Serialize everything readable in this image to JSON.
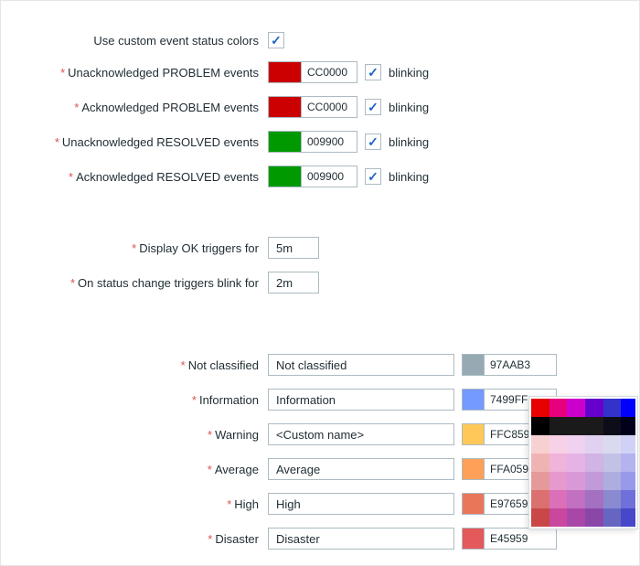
{
  "labels": {
    "use_custom": "Use custom event status colors",
    "unack_problem": "Unacknowledged PROBLEM events",
    "ack_problem": "Acknowledged PROBLEM events",
    "unack_resolved": "Unacknowledged RESOLVED events",
    "ack_resolved": "Acknowledged RESOLVED events",
    "display_ok": "Display OK triggers for",
    "blink_for": "On status change triggers blink for",
    "blinking": "blinking"
  },
  "use_custom_checked": true,
  "events": {
    "unack_problem": {
      "color": "#CC0000",
      "code": "CC0000",
      "blink": true
    },
    "ack_problem": {
      "color": "#CC0000",
      "code": "CC0000",
      "blink": true
    },
    "unack_resolved": {
      "color": "#009900",
      "code": "009900",
      "blink": true
    },
    "ack_resolved": {
      "color": "#009900",
      "code": "009900",
      "blink": true
    }
  },
  "timers": {
    "display_ok": "5m",
    "blink_for": "2m"
  },
  "severities": [
    {
      "label": "Not classified",
      "name": "Not classified",
      "color": "#97AAB3",
      "code": "97AAB3"
    },
    {
      "label": "Information",
      "name": "Information",
      "color": "#7499FF",
      "code": "7499FF"
    },
    {
      "label": "Warning",
      "name": "<Custom name>",
      "color": "#FFC859",
      "code": "FFC859"
    },
    {
      "label": "Average",
      "name": "Average",
      "color": "#FFA059",
      "code": "FFA059"
    },
    {
      "label": "High",
      "name": "High",
      "color": "#E97659",
      "code": "E97659"
    },
    {
      "label": "Disaster",
      "name": "Disaster",
      "color": "#E45959",
      "code": "E45959"
    }
  ],
  "palette": [
    [
      "#E60000",
      "#E6007E",
      "#CC00CC",
      "#6600CC",
      "#3333CC",
      "#0000FF"
    ],
    [
      "#000000",
      "#1A1A1A",
      "#1A1A1A",
      "#1A1A1A",
      "#0D0D1A",
      "#00001A"
    ],
    [
      "#F7D1D1",
      "#F7D1E6",
      "#F0D1F0",
      "#E0D1F0",
      "#D9D9F0",
      "#D1D1F7"
    ],
    [
      "#F0B3B3",
      "#F0B3D9",
      "#E6B3E6",
      "#D1B3E6",
      "#C2C2E6",
      "#B3B3F0"
    ],
    [
      "#E69999",
      "#E699CC",
      "#D999D9",
      "#C299D9",
      "#ADADE0",
      "#9999EA"
    ],
    [
      "#DB7070",
      "#DB70B8",
      "#C270C2",
      "#A370C2",
      "#8A8AD1",
      "#7070DB"
    ],
    [
      "#C94747",
      "#C9479E",
      "#A847A8",
      "#8A47A8",
      "#6666C2",
      "#4747C9"
    ]
  ]
}
